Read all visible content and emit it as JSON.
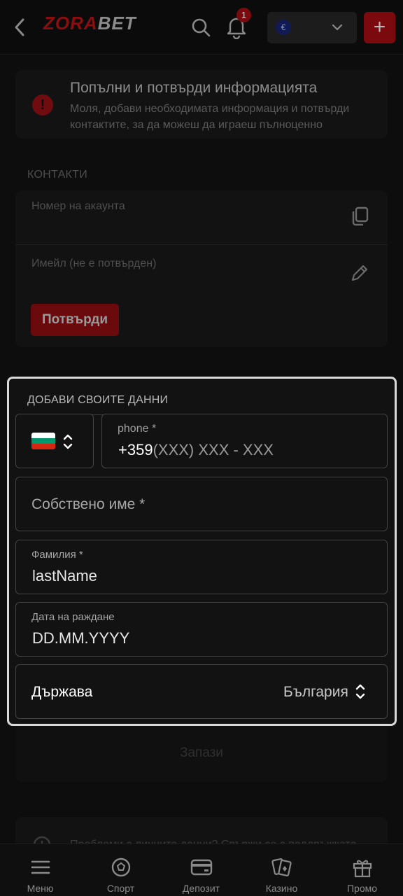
{
  "header": {
    "logo_a": "ZORA",
    "logo_b": "BET",
    "notification_count": "1",
    "currency_symbol": "€",
    "add_label": "+"
  },
  "notice": {
    "title": "Попълни и потвърди информацията",
    "text": "Моля, добави необходимата информация и потвърди контактите, за да можеш да играеш пълноценно"
  },
  "contacts": {
    "section_label": "КОНТАКТИ",
    "account_label": "Номер на акаунта",
    "email_label": "Имейл (не е потвърден)",
    "confirm_button": "Потвърди"
  },
  "form": {
    "section_label": "ДОБАВИ СВОИТЕ ДАННИ",
    "phone_label": "phone *",
    "phone_prefix": "+359",
    "phone_mask": "(XXX) XXX - XXX",
    "first_name_placeholder": "Собствено име *",
    "last_name_label": "Фамилия *",
    "last_name_value": "lastName",
    "dob_label": "Дата на раждане",
    "dob_value": "DD.MM.YYYY",
    "country_label": "Държава",
    "country_value": "България",
    "save_button": "Запази"
  },
  "help": {
    "text": "Проблеми с личните данни? Свържи се с поддръжката"
  },
  "bottom_nav": {
    "items": [
      {
        "label": "Меню",
        "icon": "menu-icon"
      },
      {
        "label": "Спорт",
        "icon": "soccer-ball-icon"
      },
      {
        "label": "Депозит",
        "icon": "card-icon"
      },
      {
        "label": "Казино",
        "icon": "cards-icon"
      },
      {
        "label": "Промо",
        "icon": "gift-icon"
      }
    ]
  },
  "colors": {
    "brand_red": "#d41219",
    "flag_white": "#ffffff",
    "flag_green": "#00966e",
    "flag_red": "#d62612"
  }
}
